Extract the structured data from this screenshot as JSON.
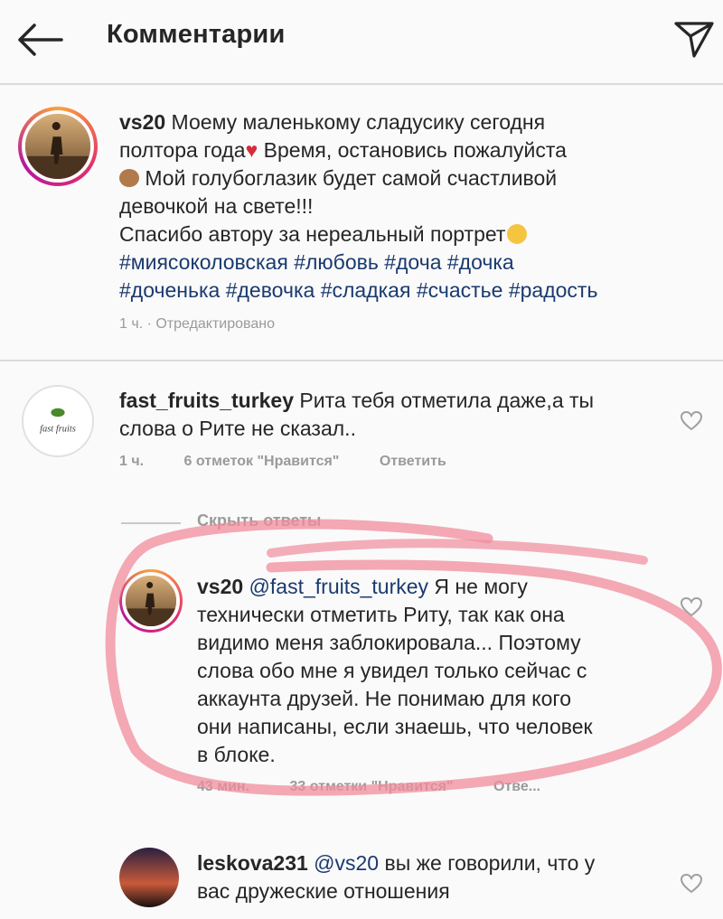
{
  "header": {
    "title": "Комментарии",
    "back_icon": "arrow-left-icon",
    "send_icon": "paper-plane-icon"
  },
  "caption": {
    "username": "vs20",
    "text_line1": " Моему маленькому сладусику сегодня",
    "text_line2": "полтора года",
    "text_line2b": " Время, остановись пожалуйста",
    "text_line3": " Мой голубоглазик будет самой счастливой",
    "text_line4": "девочкой на свете!!!",
    "text_line5": "Спасибо автору за нереальный портрет",
    "hashtags_line1": "#миясоколовская #любовь #доча #дочка",
    "hashtags_line2": "#доченька #девочка #сладкая #счастье #радость",
    "time": "1 ч. · Отредактировано"
  },
  "comments": [
    {
      "username": "fast_fruits_turkey",
      "line1": " Рита тебя отметила даже,а ты",
      "line2": "слова о Рите не сказал..",
      "time": "1 ч.",
      "likes": "6 отметок \"Нравится\"",
      "reply": "Ответить",
      "avatar_text": "fast fruits"
    }
  ],
  "replies_toggle": "Скрыть ответы",
  "replies": [
    {
      "username": "vs20",
      "mention": " @fast_fruits_turkey",
      "line1": " Я не могу",
      "line2": "технически отметить Риту, так как она",
      "line3": "видимо меня заблокировала... Поэтому",
      "line4": "слова обо мне я увидел только сейчас с",
      "line5": "аккаунта друзей. Не понимаю для кого",
      "line6": "они написаны, если знаешь, что человек",
      "line7": "в блоке.",
      "time": "43 мин.",
      "likes": "33 отметки \"Нравится\"",
      "reply": "Отве..."
    },
    {
      "username": "leskova231",
      "mention": " @vs20",
      "line1": " вы же говорили, что у",
      "line2": "вас дружеские отношения"
    }
  ],
  "colors": {
    "hashtag": "#1a3a6e",
    "highlight": "#f08c9c",
    "heart": "#c0c0c0"
  }
}
